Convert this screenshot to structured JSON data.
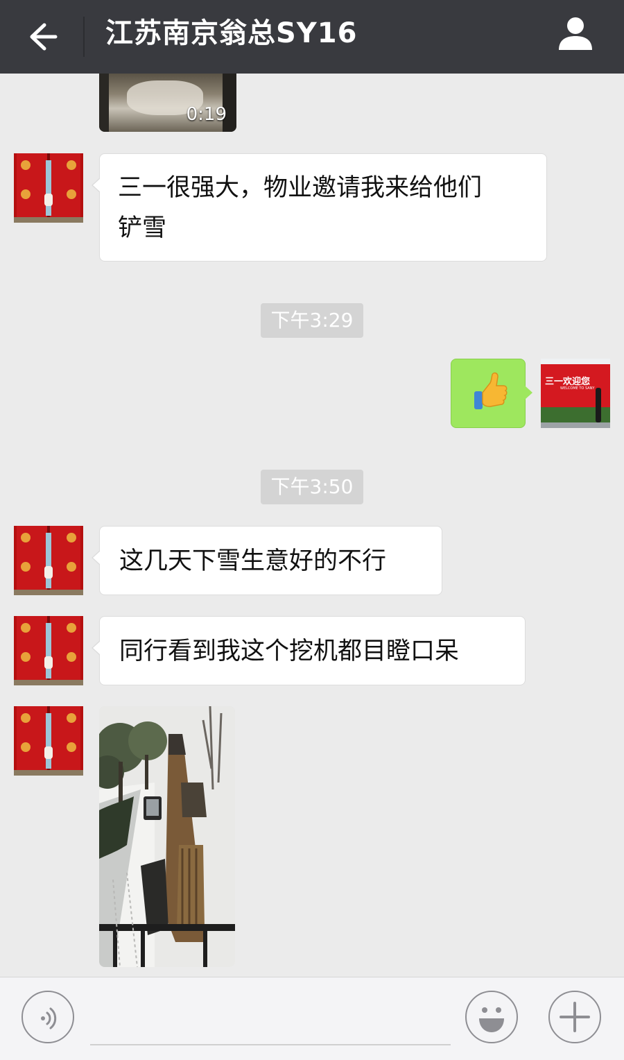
{
  "header": {
    "title": "江苏南京翁总SY16",
    "back_icon": "arrow-left-icon",
    "profile_icon": "person-icon",
    "background": "#393a3f"
  },
  "messages": {
    "video": {
      "duration": "0:19"
    },
    "msg1": {
      "text_line1": "三一很强大，物业邀请我来给他们",
      "text_line2": "铲雪"
    },
    "time1": "下午3:29",
    "sent": {
      "content": "thumbs-up-emoji",
      "bubble_color": "#9ee75e"
    },
    "self_avatar": {
      "line1": "三一欢迎您",
      "line2": "WELCOME TO SANY"
    },
    "time2": "下午3:50",
    "msg2": {
      "text": "这几天下雪生意好的不行"
    },
    "msg3": {
      "text": "同行看到我这个挖机都目瞪口呆"
    }
  },
  "input_bar": {
    "voice_icon": "voice-icon",
    "emoji_icon": "smile-icon",
    "plus_icon": "plus-icon"
  }
}
